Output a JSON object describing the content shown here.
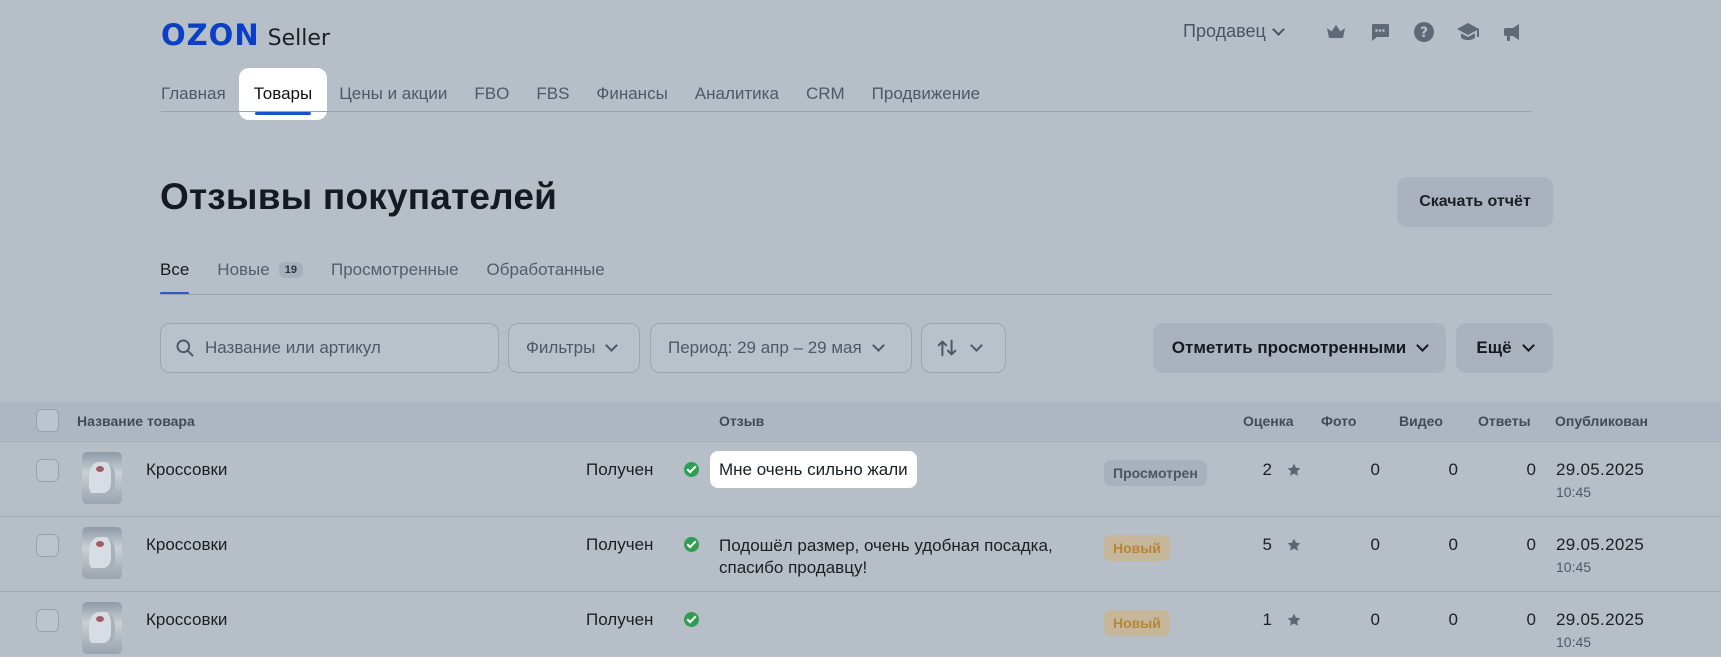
{
  "header": {
    "logo_primary": "OZON",
    "logo_secondary": "Seller",
    "seller_menu_label": "Продавец",
    "icons": [
      "crown-icon",
      "chat-icon",
      "help-icon",
      "academy-icon",
      "megaphone-icon"
    ]
  },
  "topnav": {
    "items": [
      "Главная",
      "Товары",
      "Цены и акции",
      "FBO",
      "FBS",
      "Финансы",
      "Аналитика",
      "CRM",
      "Продвижение"
    ],
    "active": "Товары"
  },
  "page": {
    "title": "Отзывы покупателей",
    "download_button": "Скачать отчёт"
  },
  "subtabs": {
    "items": [
      {
        "label": "Все",
        "count": null,
        "active": true
      },
      {
        "label": "Новые",
        "count": "19",
        "active": false
      },
      {
        "label": "Просмотренные",
        "count": null,
        "active": false
      },
      {
        "label": "Обработанные",
        "count": null,
        "active": false
      }
    ]
  },
  "toolbar": {
    "search_placeholder": "Название или артикул",
    "filters_label": "Фильтры",
    "period_label": "Период: 29 апр – 29 мая",
    "mark_viewed_label": "Отметить просмотренными",
    "more_label": "Ещё"
  },
  "table": {
    "columns": {
      "product": "Название товара",
      "review": "Отзыв",
      "rating": "Оценка",
      "photo": "Фото",
      "video": "Видео",
      "answers": "Ответы",
      "published": "Опубликован"
    },
    "rows": [
      {
        "product": "Кроссовки",
        "delivery": "Получен",
        "review": "Мне очень сильно жали",
        "review_line2": "",
        "status": "Просмотрен",
        "status_kind": "seen",
        "rating": "2",
        "photo": "0",
        "video": "0",
        "answers": "0",
        "date": "29.05.2025",
        "time": "10:45",
        "highlighted": true
      },
      {
        "product": "Кроссовки",
        "delivery": "Получен",
        "review": "Подошёл размер, очень удобная посадка,",
        "review_line2": "спасибо продавцу!",
        "status": "Новый",
        "status_kind": "new",
        "rating": "5",
        "photo": "0",
        "video": "0",
        "answers": "0",
        "date": "29.05.2025",
        "time": "10:45",
        "highlighted": false
      },
      {
        "product": "Кроссовки",
        "delivery": "Получен",
        "review": "",
        "review_line2": "",
        "status": "Новый",
        "status_kind": "new",
        "rating": "1",
        "photo": "0",
        "video": "0",
        "answers": "0",
        "date": "29.05.2025",
        "time": "10:45",
        "highlighted": false
      }
    ]
  },
  "colors": {
    "brand": "#0b3fc4",
    "active_underline": "#1f4fd1",
    "ok_green": "#2f9e52",
    "new_badge_text": "#b5863a"
  }
}
